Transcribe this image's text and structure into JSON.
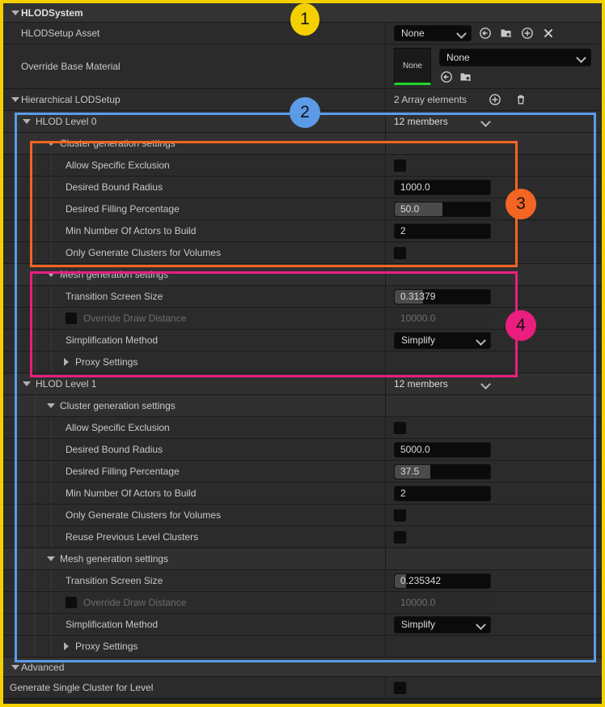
{
  "panel": {
    "title": "HLODSystem"
  },
  "rows": {
    "hlod_setup_asset": {
      "label": "HLODSetup Asset",
      "value": "None",
      "icons": [
        "use-selected-asset-icon",
        "browse-content-icon",
        "new-asset-icon",
        "clear-asset-icon"
      ]
    },
    "override_base_material": {
      "label": "Override Base Material",
      "thumbnail_text": "None",
      "value": "None",
      "icons": [
        "use-selected-asset-icon",
        "browse-content-icon"
      ]
    },
    "hierarchical_lodsetup": {
      "label": "Hierarchical LODSetup",
      "value": "2 Array elements",
      "icons": [
        "add-element-icon",
        "delete-all-icon"
      ]
    },
    "advanced": {
      "label": "Advanced"
    },
    "generate_single_cluster": {
      "label": "Generate Single Cluster for Level",
      "checked": false
    }
  },
  "levels": [
    {
      "label": "HLOD Level 0",
      "members": "12 members",
      "cluster_group": "Cluster generation settings",
      "cluster_settings": [
        {
          "label": "Allow Specific Exclusion",
          "type": "checkbox",
          "checked": false
        },
        {
          "label": "Desired Bound Radius",
          "type": "number",
          "value": "1000.0",
          "fill_pct": 0
        },
        {
          "label": "Desired Filling Percentage",
          "type": "number",
          "value": "50.0",
          "fill_pct": 50
        },
        {
          "label": "Min Number Of Actors to Build",
          "type": "number",
          "value": "2",
          "fill_pct": 0
        },
        {
          "label": "Only Generate Clusters for Volumes",
          "type": "checkbox",
          "checked": false
        }
      ],
      "mesh_group": "Mesh generation settings",
      "mesh_settings": [
        {
          "label": "Transition Screen Size",
          "type": "number",
          "value": "0.31379",
          "fill_pct": 30
        },
        {
          "label": "Override Draw Distance",
          "type": "checknumber",
          "checked": false,
          "value": "10000.0",
          "disabled": true,
          "fill_pct": 0
        },
        {
          "label": "Simplification Method",
          "type": "dropdown",
          "value": "Simplify"
        },
        {
          "label": "Proxy Settings",
          "type": "group",
          "expanded": false
        }
      ]
    },
    {
      "label": "HLOD Level 1",
      "members": "12 members",
      "cluster_group": "Cluster generation settings",
      "cluster_settings": [
        {
          "label": "Allow Specific Exclusion",
          "type": "checkbox",
          "checked": false
        },
        {
          "label": "Desired Bound Radius",
          "type": "number",
          "value": "5000.0",
          "fill_pct": 0
        },
        {
          "label": "Desired Filling Percentage",
          "type": "number",
          "value": "37.5",
          "fill_pct": 37.5
        },
        {
          "label": "Min Number Of Actors to Build",
          "type": "number",
          "value": "2",
          "fill_pct": 0
        },
        {
          "label": "Only Generate Clusters for Volumes",
          "type": "checkbox",
          "checked": false
        },
        {
          "label": "Reuse Previous Level Clusters",
          "type": "checkbox",
          "checked": false
        }
      ],
      "mesh_group": "Mesh generation settings",
      "mesh_settings": [
        {
          "label": "Transition Screen Size",
          "type": "number",
          "value": "0.235342",
          "fill_pct": 12
        },
        {
          "label": "Override Draw Distance",
          "type": "checknumber",
          "checked": false,
          "value": "10000.0",
          "disabled": true,
          "fill_pct": 0
        },
        {
          "label": "Simplification Method",
          "type": "dropdown",
          "value": "Simplify"
        },
        {
          "label": "Proxy Settings",
          "type": "group",
          "expanded": false
        }
      ]
    }
  ],
  "annotations": {
    "badges": [
      {
        "id": "1",
        "text": "1",
        "color": "#f5d000"
      },
      {
        "id": "2",
        "text": "2",
        "color": "#5b9be8"
      },
      {
        "id": "3",
        "text": "3",
        "color": "#f26522"
      },
      {
        "id": "4",
        "text": "4",
        "color": "#e91e7e"
      }
    ]
  }
}
